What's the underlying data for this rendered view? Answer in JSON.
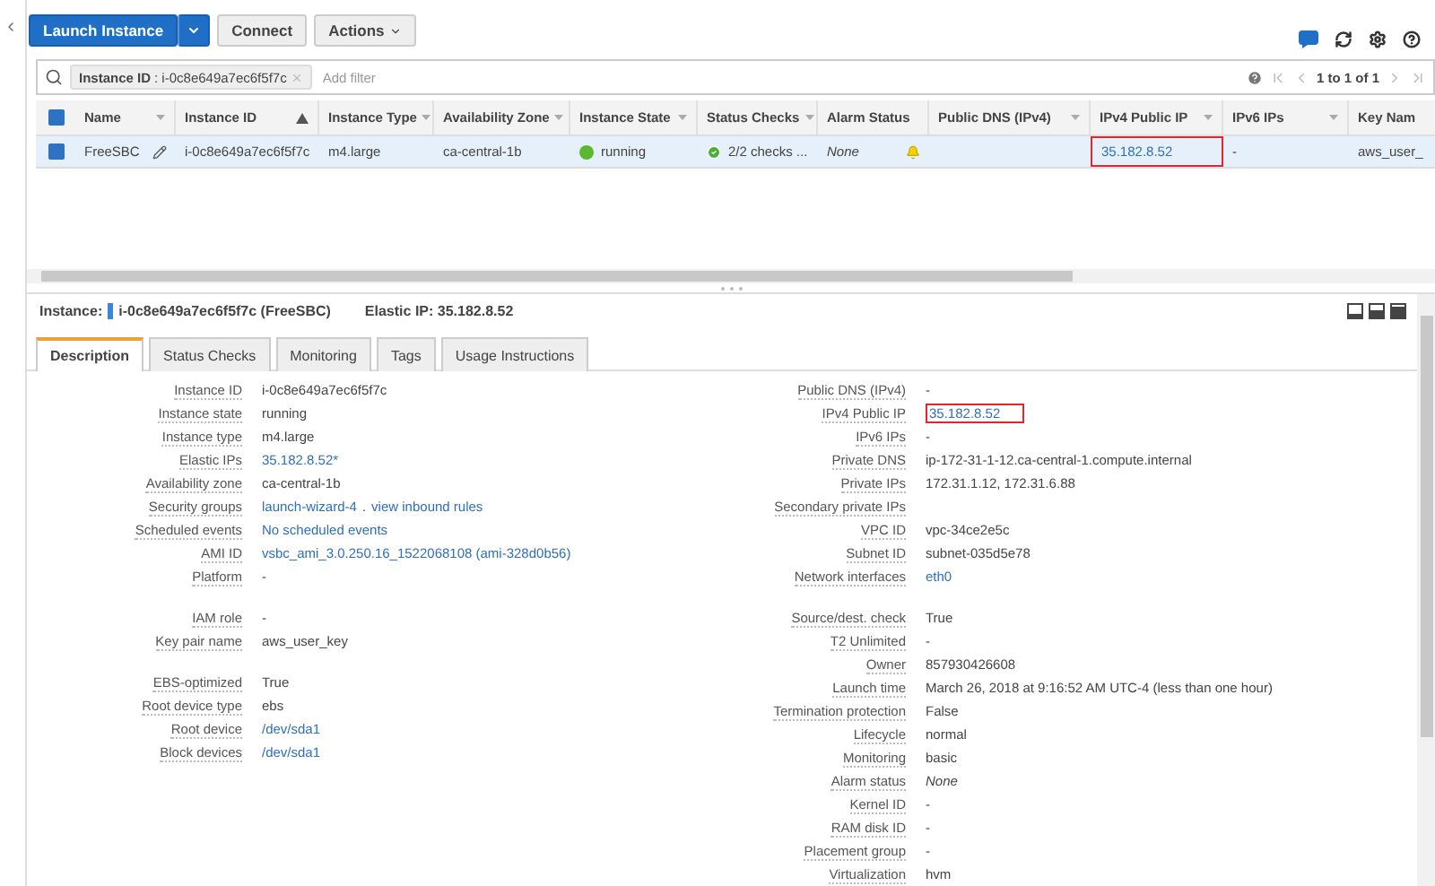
{
  "toolbar": {
    "buttons": [
      {
        "label": "Launch Instance",
        "kind": "primary"
      },
      {
        "label": "Connect",
        "kind": "plain"
      },
      {
        "label": "Actions",
        "kind": "menu"
      }
    ]
  },
  "filter": {
    "token_key": "Instance ID",
    "token_separator": ":",
    "token_value": "i-0c8e649a7ec6f5f7c",
    "placeholder": "Add filter",
    "pagination": "1 to 1 of 1"
  },
  "table": {
    "all_checked": true,
    "columns": [
      {
        "label": "Name",
        "sorted": false,
        "menu": true
      },
      {
        "label": "Instance ID",
        "sorted": true,
        "menu": false
      },
      {
        "label": "Instance Type",
        "sorted": false,
        "menu": true
      },
      {
        "label": "Availability Zone",
        "sorted": false,
        "menu": true
      },
      {
        "label": "Instance State",
        "sorted": false,
        "menu": true
      },
      {
        "label": "Status Checks",
        "sorted": false,
        "menu": true
      },
      {
        "label": "Alarm Status",
        "sorted": false,
        "menu": false
      },
      {
        "label": "Public DNS (IPv4)",
        "sorted": false,
        "menu": true
      },
      {
        "label": "IPv4 Public IP",
        "sorted": false,
        "menu": true
      },
      {
        "label": "IPv6 IPs",
        "sorted": false,
        "menu": true
      },
      {
        "label": "Key Nam",
        "sorted": false,
        "menu": false
      }
    ],
    "rows": [
      {
        "selected": true,
        "checked": true,
        "cells": [
          {
            "kind": "name",
            "text": "FreeSBC"
          },
          {
            "kind": "text",
            "text": "i-0c8e649a7ec6f5f7c"
          },
          {
            "kind": "text",
            "text": "m4.large"
          },
          {
            "kind": "text",
            "text": "ca-central-1b"
          },
          {
            "kind": "state",
            "text": "running",
            "color": "#5cb82e"
          },
          {
            "kind": "checks",
            "text": "2/2 checks ..."
          },
          {
            "kind": "alarm",
            "text": "None"
          },
          {
            "kind": "empty"
          },
          {
            "kind": "link",
            "text": "35.182.8.52",
            "highlighted": true
          },
          {
            "kind": "text",
            "text": "-"
          },
          {
            "kind": "text",
            "text": "aws_user_"
          }
        ]
      }
    ]
  },
  "instance_header": {
    "label": "Instance:",
    "instance": "i-0c8e649a7ec6f5f7c (FreeSBC)",
    "elastic_ip": "Elastic IP: 35.182.8.52"
  },
  "tabs": [
    {
      "label": "Description",
      "selected": true
    },
    {
      "label": "Status Checks",
      "selected": false
    },
    {
      "label": "Monitoring",
      "selected": false
    },
    {
      "label": "Tags",
      "selected": false
    },
    {
      "label": "Usage Instructions",
      "selected": false
    }
  ],
  "details_left": [
    [
      {
        "label": "Instance ID",
        "value": "i-0c8e649a7ec6f5f7c",
        "kind": "text"
      },
      {
        "label": "Instance state",
        "value": "running",
        "kind": "text"
      },
      {
        "label": "Instance type",
        "value": "m4.large",
        "kind": "text"
      },
      {
        "label": "Elastic IPs",
        "value": "35.182.8.52*",
        "kind": "link"
      },
      {
        "label": "Availability zone",
        "value": "ca-central-1b",
        "kind": "text"
      },
      {
        "label": "Security groups",
        "kind": "links",
        "values": [
          "launch-wizard-4",
          ".",
          "view inbound rules"
        ]
      },
      {
        "label": "Scheduled events",
        "value": "No scheduled events",
        "kind": "link"
      },
      {
        "label": "AMI ID",
        "value": "vsbc_ami_3.0.250.16_1522068108 (ami-328d0b56)",
        "kind": "link"
      },
      {
        "label": "Platform",
        "value": "-",
        "kind": "text"
      }
    ],
    [
      {
        "label": "IAM role",
        "value": "-",
        "kind": "text"
      },
      {
        "label": "Key pair name",
        "value": "aws_user_key",
        "kind": "text"
      }
    ],
    [
      {
        "label": "EBS-optimized",
        "value": "True",
        "kind": "text"
      },
      {
        "label": "Root device type",
        "value": "ebs",
        "kind": "text"
      },
      {
        "label": "Root device",
        "value": "/dev/sda1",
        "kind": "link"
      },
      {
        "label": "Block devices",
        "value": "/dev/sda1",
        "kind": "link"
      }
    ]
  ],
  "details_right": [
    [
      {
        "label": "Public DNS (IPv4)",
        "value": "-",
        "kind": "text"
      },
      {
        "label": "IPv4 Public IP",
        "value": "35.182.8.52",
        "kind": "link",
        "highlighted": true
      },
      {
        "label": "IPv6 IPs",
        "value": "-",
        "kind": "text"
      },
      {
        "label": "Private DNS",
        "value": "ip-172-31-1-12.ca-central-1.compute.internal",
        "kind": "text"
      },
      {
        "label": "Private IPs",
        "value": "172.31.1.12, 172.31.6.88",
        "kind": "text"
      },
      {
        "label": "Secondary private IPs",
        "kind": "empty"
      },
      {
        "label": "VPC ID",
        "value": "vpc-34ce2e5c",
        "kind": "text"
      },
      {
        "label": "Subnet ID",
        "value": "subnet-035d5e78",
        "kind": "text"
      },
      {
        "label": "Network interfaces",
        "value": "eth0",
        "kind": "link"
      }
    ],
    [
      {
        "label": "Source/dest. check",
        "value": "True",
        "kind": "text"
      },
      {
        "label": "T2 Unlimited",
        "value": "-",
        "kind": "text"
      },
      {
        "label": "Owner",
        "value": "857930426608",
        "kind": "text"
      },
      {
        "label": "Launch time",
        "value": "March 26, 2018 at 9:16:52 AM UTC-4 (less than one hour)",
        "kind": "text"
      },
      {
        "label": "Termination protection",
        "value": "False",
        "kind": "text"
      },
      {
        "label": "Lifecycle",
        "value": "normal",
        "kind": "text"
      },
      {
        "label": "Monitoring",
        "value": "basic",
        "kind": "text"
      },
      {
        "label": "Alarm status",
        "value": "None",
        "kind": "italic"
      },
      {
        "label": "Kernel ID",
        "value": "-",
        "kind": "text"
      },
      {
        "label": "RAM disk ID",
        "value": "-",
        "kind": "text"
      },
      {
        "label": "Placement group",
        "value": "-",
        "kind": "text"
      },
      {
        "label": "Virtualization",
        "value": "hvm",
        "kind": "text"
      }
    ]
  ]
}
